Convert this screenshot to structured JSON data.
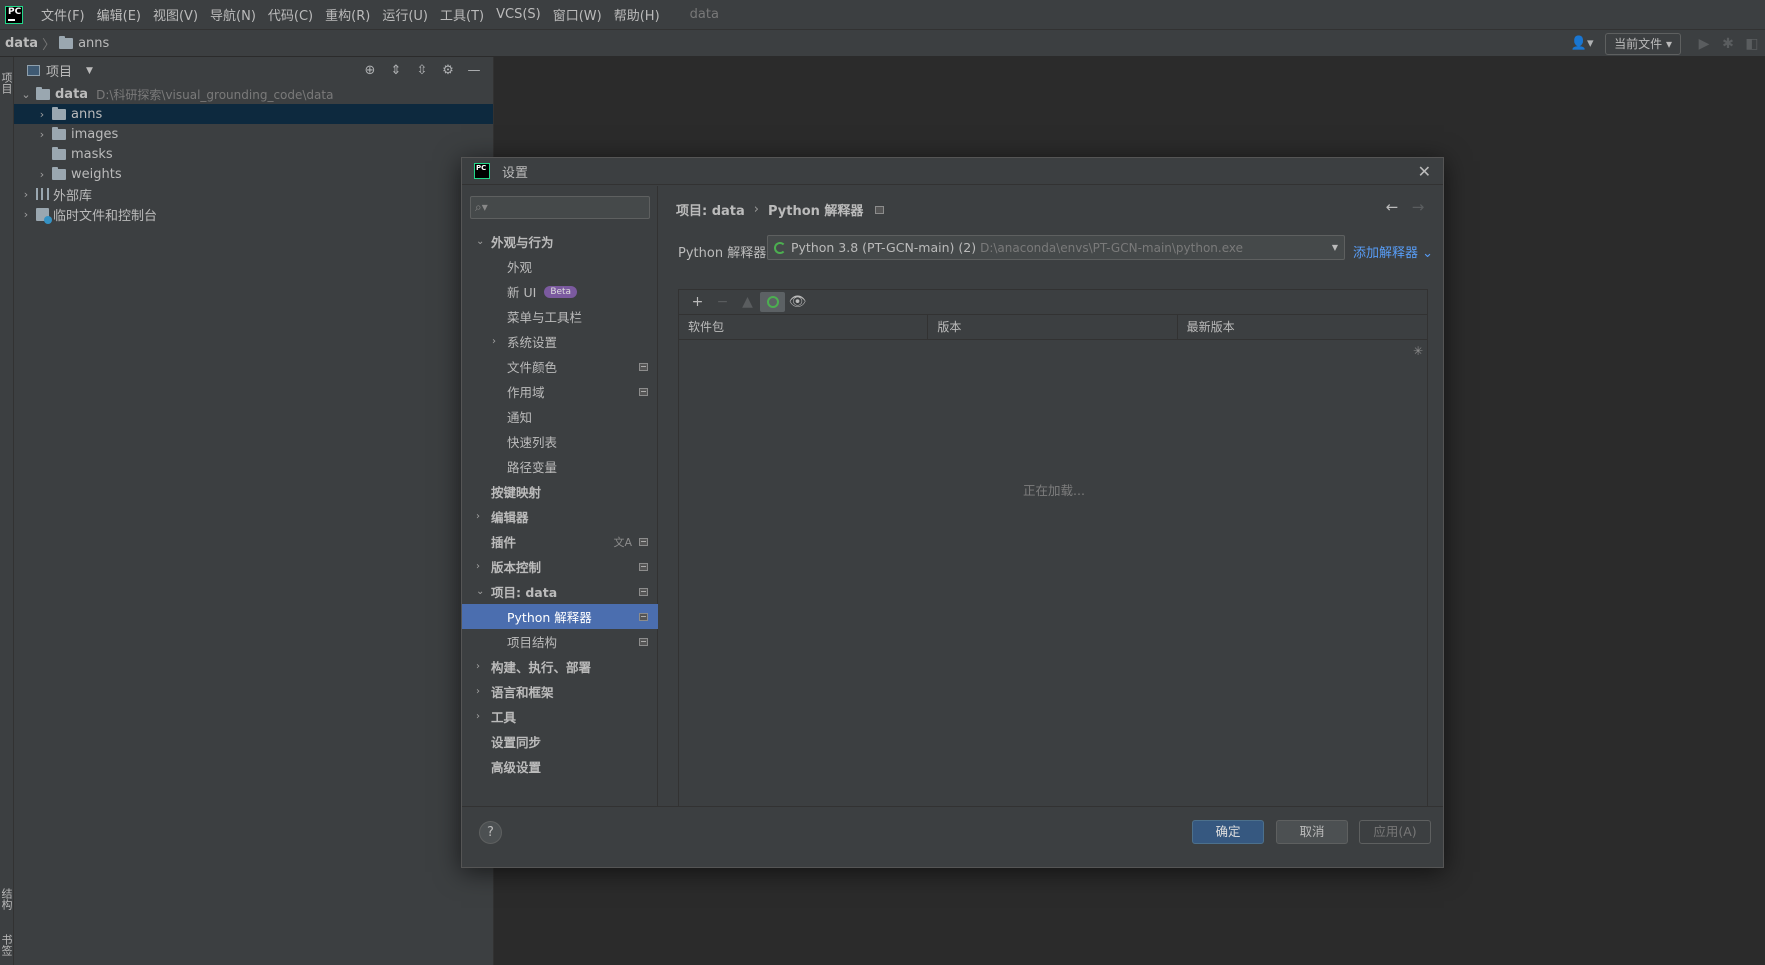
{
  "menubar": {
    "logo": "PC",
    "items": [
      "文件(F)",
      "编辑(E)",
      "视图(V)",
      "导航(N)",
      "代码(C)",
      "重构(R)",
      "运行(U)",
      "工具(T)",
      "VCS(S)",
      "窗口(W)",
      "帮助(H)"
    ],
    "project_title": "data"
  },
  "navbar": {
    "crumb_root": "data",
    "crumb_child": "anns",
    "run_config": "当前文件"
  },
  "left_strip": {
    "project_tab": "项目",
    "structure_tab": "结构",
    "bookmarks_tab": "书签"
  },
  "project_panel": {
    "title": "项目",
    "root_name": "data",
    "root_path": "D:\\科研探索\\visual_grounding_code\\data",
    "folders": [
      "anns",
      "images",
      "masks",
      "weights"
    ],
    "external_libs": "外部库",
    "scratches": "临时文件和控制台"
  },
  "dialog": {
    "title": "设置",
    "logo": "PC",
    "tree": {
      "appearance_behavior": "外观与行为",
      "appearance": "外观",
      "new_ui": "新 UI",
      "beta": "Beta",
      "menus_toolbars": "菜单与工具栏",
      "system_settings": "系统设置",
      "file_colors": "文件颜色",
      "scopes": "作用域",
      "notifications": "通知",
      "quick_lists": "快速列表",
      "path_variables": "路径变量",
      "keymap": "按键映射",
      "editor": "编辑器",
      "plugins": "插件",
      "version_control": "版本控制",
      "project_data": "项目: data",
      "python_interpreter": "Python 解释器",
      "project_structure": "项目结构",
      "build_exec_deploy": "构建、执行、部署",
      "languages_frameworks": "语言和框架",
      "tools": "工具",
      "settings_sync": "设置同步",
      "advanced_settings": "高级设置"
    },
    "breadcrumb": {
      "parent": "项目: data",
      "current": "Python 解释器"
    },
    "interpreter": {
      "label": "Python 解释器:",
      "name": "Python 3.8 (PT-GCN-main) (2)",
      "path": "D:\\anaconda\\envs\\PT-GCN-main\\python.exe",
      "add_link": "添加解释器"
    },
    "packages": {
      "columns": [
        "软件包",
        "版本",
        "最新版本"
      ],
      "loading": "正在加载..."
    },
    "footer": {
      "help": "?",
      "ok": "确定",
      "cancel": "取消",
      "apply": "应用(A)"
    }
  },
  "colors": {
    "accent": "#4b6eaf",
    "link": "#589df6",
    "selection": "#0d293e",
    "primary_button": "#365880"
  }
}
